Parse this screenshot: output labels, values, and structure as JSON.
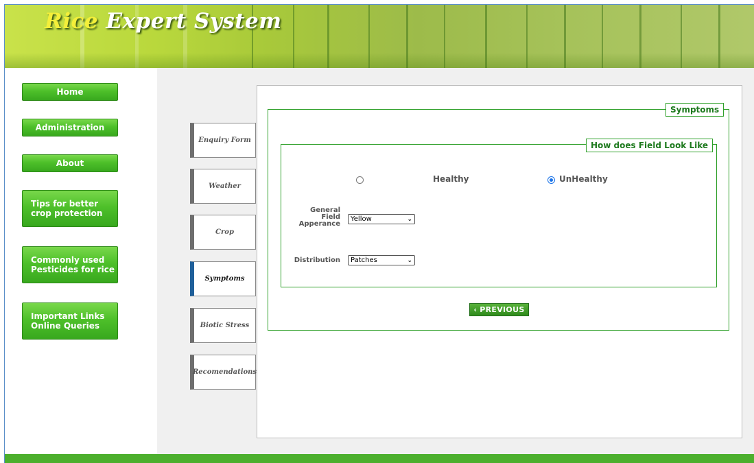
{
  "header": {
    "title_first": "Rice",
    "title_rest": " Expert System"
  },
  "sidebar": {
    "items": [
      {
        "label": "Home"
      },
      {
        "label": "Administration"
      },
      {
        "label": "About"
      },
      {
        "line1": "Tips for better",
        "line2": "crop protection"
      },
      {
        "line1": "Commonly used",
        "line2": "Pesticides for rice"
      },
      {
        "line1": "Important Links",
        "line2": "Online Queries"
      }
    ]
  },
  "tabs": [
    {
      "label": "Enquiry Form",
      "active": false
    },
    {
      "label": "Weather",
      "active": false
    },
    {
      "label": "Crop",
      "active": false
    },
    {
      "label": "Symptoms",
      "active": true
    },
    {
      "label": "Biotic Stress",
      "active": false
    },
    {
      "label": "Recomendations",
      "active": false
    }
  ],
  "main": {
    "outer_legend": "Symptoms",
    "inner_legend": "How does Field Look Like",
    "radios": [
      {
        "label": "Healthy",
        "checked": false
      },
      {
        "label": "UnHealthy",
        "checked": true
      }
    ],
    "general_field": {
      "label_line1": "General",
      "label_line2": "Field",
      "label_line3": "Apperance",
      "value": "Yellow"
    },
    "distribution": {
      "label": "Distribution",
      "value": "Patches"
    },
    "previous_label": "PREVIOUS",
    "previous_chevron": "‹"
  },
  "colors": {
    "accent_green": "#4caf2d",
    "legend_green": "#1e7a1e",
    "active_tab_blue": "#1f5f9a",
    "radio_blue": "#1a73e8"
  }
}
